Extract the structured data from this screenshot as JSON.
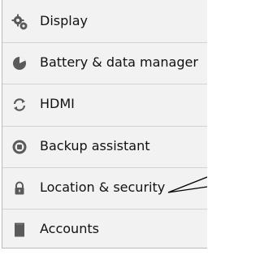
{
  "settings_list": {
    "items": [
      {
        "label": "Display",
        "icon": "display-settings-icon"
      },
      {
        "label": "Battery & data manager",
        "icon": "battery-pie-icon"
      },
      {
        "label": "HDMI",
        "icon": "hdmi-sync-icon"
      },
      {
        "label": "Backup assistant",
        "icon": "backup-assistant-icon"
      },
      {
        "label": "Location & security",
        "icon": "lock-icon"
      },
      {
        "label": "Accounts",
        "icon": "accounts-icon"
      }
    ]
  },
  "colors": {
    "background": "#f2f2f2",
    "text": "#111111",
    "icon": "#5a5a5a",
    "divider": "#d2d2d2"
  }
}
